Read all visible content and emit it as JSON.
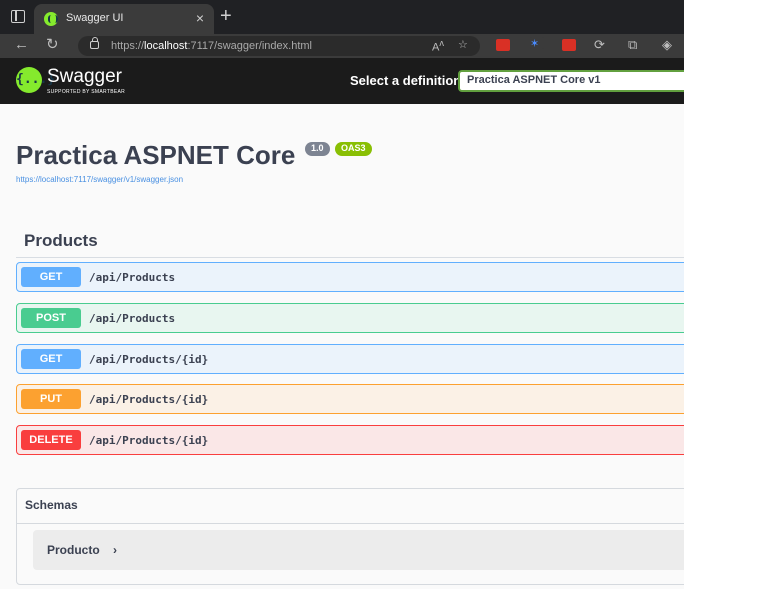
{
  "browser": {
    "tab_title": "Swagger UI",
    "tab_close": "×",
    "new_tab": "+",
    "url_prefix": "https://",
    "url_host": "localhost",
    "url_rest": ":7117/swagger/index.html"
  },
  "topbar": {
    "logo_glyph": "{...}",
    "logo_text": "Swagger",
    "logo_sub": "Supported by SMARTBEAR",
    "definition_label": "Select a definition",
    "definition_selected": "Practica ASPNET Core v1"
  },
  "info": {
    "title": "Practica ASPNET Core",
    "version": "1.0",
    "oas": "OAS3",
    "spec_url": "https://localhost:7117/swagger/v1/swagger.json"
  },
  "tag": {
    "name": "Products"
  },
  "operations": [
    {
      "method": "GET",
      "path": "/api/Products"
    },
    {
      "method": "POST",
      "path": "/api/Products"
    },
    {
      "method": "GET",
      "path": "/api/Products/{id}"
    },
    {
      "method": "PUT",
      "path": "/api/Products/{id}"
    },
    {
      "method": "DELETE",
      "path": "/api/Products/{id}"
    }
  ],
  "schemas": {
    "title": "Schemas",
    "models": [
      {
        "name": "Producto",
        "arrow": "›"
      }
    ]
  },
  "colors": {
    "get": "#61affe",
    "post": "#49cc90",
    "put": "#fca130",
    "delete": "#f93e3e",
    "swagger_green": "#85ea2d"
  }
}
